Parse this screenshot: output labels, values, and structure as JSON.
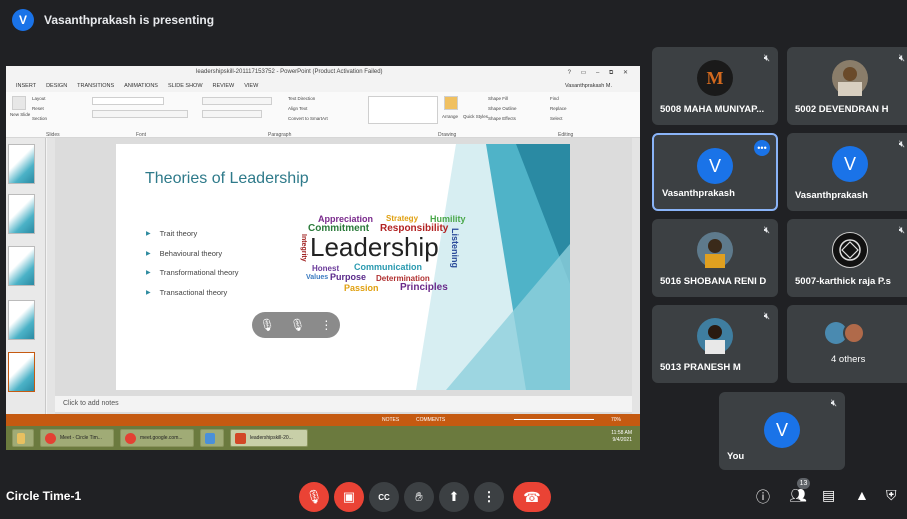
{
  "header": {
    "avatar_letter": "V",
    "presenting_text": "Vasanthprakash is presenting"
  },
  "powerpoint": {
    "window_title": "leadershipskill-201117153752 - PowerPoint (Product Activation Failed)",
    "window_controls": "? ▭ – ⧉ ✕",
    "menu": [
      "INSERT",
      "DESIGN",
      "TRANSITIONS",
      "ANIMATIONS",
      "SLIDE SHOW",
      "REVIEW",
      "VIEW"
    ],
    "user": "Vasanthprakash M.",
    "ribbon_groups": {
      "slides": "Slides",
      "font": "Font",
      "paragraph": "Paragraph",
      "drawing": "Drawing",
      "editing": "Editing"
    },
    "ribbon_items": {
      "layout": "Layout",
      "reset": "Reset",
      "new_slide": "New Slide",
      "section": "Section",
      "text_direction": "Text Direction",
      "align_text": "Align Text",
      "convert_smartart": "Convert to SmartArt",
      "arrange": "Arrange",
      "quick_styles": "Quick Styles",
      "shape_fill": "Shape Fill",
      "shape_outline": "Shape Outline",
      "shape_effects": "Shape Effects",
      "find": "Find",
      "replace": "Replace",
      "select": "Select"
    },
    "slide": {
      "title": "Theories of Leadership",
      "bullets": [
        "Trait theory",
        "Behavioural theory",
        "Transformational theory",
        "Transactional theory"
      ],
      "wordcloud": [
        "Appreciation",
        "Strategy",
        "Humility",
        "Commitment",
        "Responsibility",
        "Leadership",
        "Listening",
        "Integrity",
        "Honest",
        "Communication",
        "Values",
        "Purpose",
        "Determination",
        "Passion",
        "Principles"
      ]
    },
    "notes_placeholder": "Click to add notes",
    "status": {
      "notes": "NOTES",
      "comments": "COMMENTS",
      "zoom": "70%"
    },
    "taskbar": [
      {
        "label": "Meet - Circle Tim...",
        "color": "#e8e8e8"
      },
      {
        "label": "meet.google.com...",
        "color": "#e8e8e8"
      },
      {
        "label": "",
        "color": "#4a90d9"
      },
      {
        "label": "leadershipskill-20...",
        "color": "#d24726"
      }
    ],
    "clock_time": "11:58 AM",
    "clock_date": "9/4/2021"
  },
  "participants": [
    {
      "name": "5008 MAHA MUNIYAP...",
      "avatar": "M",
      "avatar_color": "#1a1a1a",
      "letter_color": "#d2691e"
    },
    {
      "name": "5002 DEVENDRAN H",
      "avatar": "",
      "avatar_color": "#8a7d6a"
    },
    {
      "name": "Vasanthprakash",
      "avatar": "V",
      "avatar_color": "#1a73e8"
    },
    {
      "name": "Vasanthprakash",
      "avatar": "V",
      "avatar_color": "#1a73e8"
    },
    {
      "name": "5016 SHOBANA RENI D",
      "avatar": "",
      "avatar_color": "#5e7a8c"
    },
    {
      "name": "5007-karthick raja P.s",
      "avatar": "",
      "avatar_color": "#111111"
    },
    {
      "name": "5013 PRANESH M",
      "avatar": "",
      "avatar_color": "#3f7ea0"
    },
    {
      "name": "4 others",
      "avatar": "",
      "avatar_color": "#6e6e6e"
    },
    {
      "name": "You",
      "avatar": "V",
      "avatar_color": "#1a73e8"
    }
  ],
  "bottom": {
    "meeting_name": "Circle Time-1",
    "participant_count": "13"
  },
  "colors": {
    "background": "#202124",
    "tile": "#3c4043",
    "accent": "#1a73e8",
    "danger": "#ea4335"
  }
}
